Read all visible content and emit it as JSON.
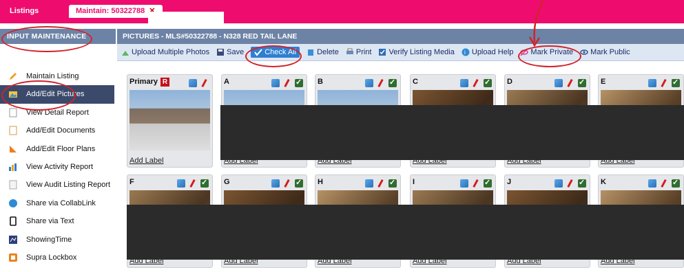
{
  "topbar": {
    "listings_tab": "Listings",
    "maintain_tab": "Maintain: 50322788",
    "close_glyph": "✕"
  },
  "sidebar": {
    "title": "INPUT MAINTENANCE",
    "items": [
      {
        "label": "Maintain Listing",
        "icon": "pencil-icon",
        "active": false
      },
      {
        "label": "Add/Edit Pictures",
        "icon": "pictures-icon",
        "active": true
      },
      {
        "label": "View Detail Report",
        "icon": "report-icon",
        "active": false
      },
      {
        "label": "Add/Edit Documents",
        "icon": "document-icon",
        "active": false
      },
      {
        "label": "Add/Edit Floor Plans",
        "icon": "floorplan-icon",
        "active": false
      },
      {
        "label": "View Activity Report",
        "icon": "chart-icon",
        "active": false
      },
      {
        "label": "View Audit Listing Report",
        "icon": "audit-icon",
        "active": false
      },
      {
        "label": "Share via CollabLink",
        "icon": "collab-icon",
        "active": false
      },
      {
        "label": "Share via Text",
        "icon": "phone-icon",
        "active": false
      },
      {
        "label": "ShowingTime",
        "icon": "showingtime-icon",
        "active": false
      },
      {
        "label": "Supra Lockbox",
        "icon": "lockbox-icon",
        "active": false
      }
    ]
  },
  "main": {
    "title": "PICTURES - MLS#50322788 - N328 RED TAIL LANE",
    "toolbar": {
      "upload_multiple": "Upload Multiple Photos",
      "save": "Save",
      "check_all": "Check All",
      "delete": "Delete",
      "print": "Print",
      "verify": "Verify Listing Media",
      "upload_help": "Upload Help",
      "mark_private": "Mark Private",
      "mark_public": "Mark Public"
    },
    "add_label_text": "Add Label",
    "cards_row1": [
      {
        "label": "Primary",
        "badge": "R"
      },
      {
        "label": "A"
      },
      {
        "label": "B"
      },
      {
        "label": "C"
      },
      {
        "label": "D"
      },
      {
        "label": "E"
      }
    ],
    "cards_row2": [
      {
        "label": "F"
      },
      {
        "label": "G"
      },
      {
        "label": "H"
      },
      {
        "label": "I"
      },
      {
        "label": "J"
      },
      {
        "label": "K"
      }
    ]
  },
  "colors": {
    "brand_pink": "#ee0d6e",
    "header_blue": "#6d83a6",
    "annotation_red": "#d2232a"
  }
}
